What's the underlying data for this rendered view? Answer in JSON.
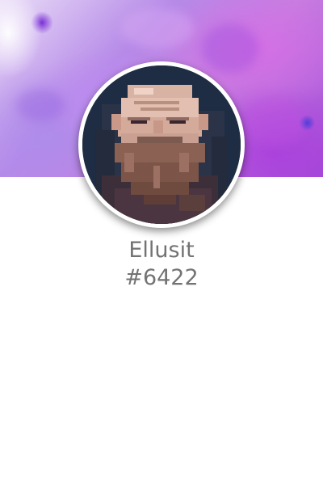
{
  "profile": {
    "username": "Ellusit",
    "discriminator": "#6422",
    "avatar_icon": "pixel-art-bearded-old-man-icon",
    "banner": "purple-watercolor-banner"
  },
  "colors": {
    "background": "#ffffff",
    "text": "#737373",
    "avatar_bg": "#1e2d43",
    "banner_accent": "#b16de0"
  }
}
